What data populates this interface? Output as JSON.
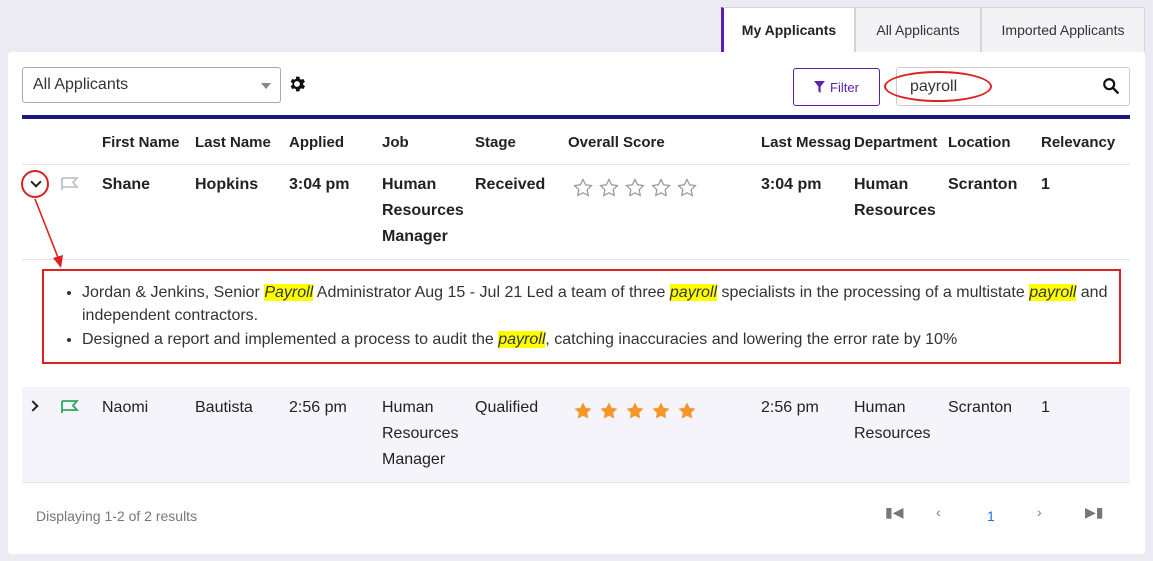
{
  "tabs": [
    {
      "label": "My Applicants",
      "active": true
    },
    {
      "label": "All Applicants",
      "active": false
    },
    {
      "label": "Imported Applicants",
      "active": false
    }
  ],
  "toolbar": {
    "view_select": "All Applicants",
    "filter_label": "Filter",
    "search_value": "payroll"
  },
  "table": {
    "headers": [
      "First Name",
      "Last Name",
      "Applied",
      "Job",
      "Stage",
      "Overall Score",
      "Last Messag",
      "Department",
      "Location",
      "Relevancy"
    ],
    "rows": [
      {
        "first_name": "Shane",
        "last_name": "Hopkins",
        "applied": "3:04 pm",
        "job_line1": "Human",
        "job_line2": "Resources",
        "job_line3": "Manager",
        "stage": "Received",
        "score": 0,
        "last_message": "3:04 pm",
        "dept_line1": "Human",
        "dept_line2": "Resources",
        "location": "Scranton",
        "relevancy": "1",
        "expanded": true,
        "flag_color": "#bbbbbb",
        "details": {
          "item1_a": "Jordan & Jenkins, Senior ",
          "item1_hl1": "Payroll",
          "item1_b": " Administrator Aug 15 - Jul 21 Led a team of three ",
          "item1_hl2": "payroll",
          "item1_c": " specialists in the processing of a multistate ",
          "item1_hl3": "payroll",
          "item1_d": " and independent contractors.",
          "item2_a": "Designed a report and implemented a process to audit the ",
          "item2_hl": "payroll",
          "item2_b": ", catching inaccuracies and lowering the error rate by 10%"
        }
      },
      {
        "first_name": "Naomi",
        "last_name": "Bautista",
        "applied": "2:56 pm",
        "job_line1": "Human",
        "job_line2": "Resources",
        "job_line3": "Manager",
        "stage": "Qualified",
        "score": 5,
        "last_message": "2:56 pm",
        "dept_line1": "Human",
        "dept_line2": "Resources",
        "location": "Scranton",
        "relevancy": "1",
        "expanded": false,
        "flag_color": "#2eaa5c"
      }
    ]
  },
  "footer": {
    "results_text": "Displaying 1-2 of 2 results",
    "current_page": "1"
  },
  "icons": {
    "gear": "gear-icon",
    "filter": "filter-icon",
    "search": "search-icon",
    "flag": "flag-icon",
    "star": "star-icon"
  },
  "colors": {
    "accent": "#5b1fb0",
    "annotation_red": "#e02020",
    "highlight": "#ffff00",
    "star_filled": "#f5962a",
    "link_blue": "#1a73e8"
  }
}
